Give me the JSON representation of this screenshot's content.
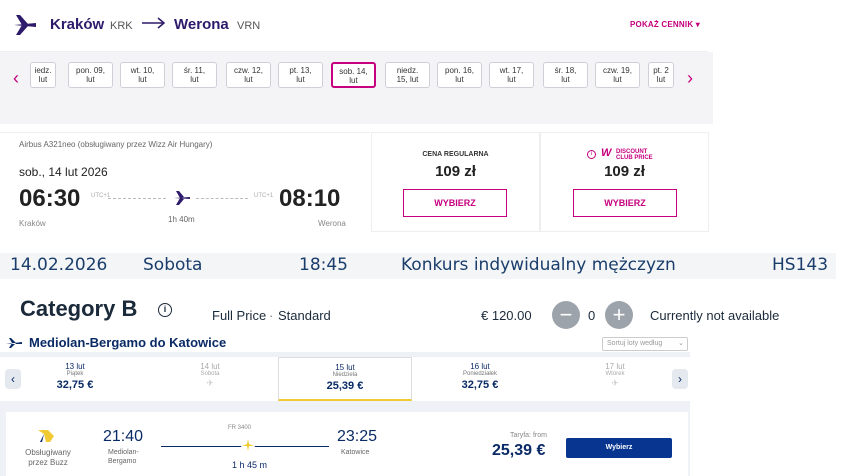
{
  "wizz": {
    "route": {
      "origin": "Kraków",
      "origin_code": "KRK",
      "destination": "Werona",
      "destination_code": "VRN",
      "price_list_label": "POKAŻ CENNIK"
    },
    "date_strip": [
      {
        "l1": "iedz.",
        "l2": "lut"
      },
      {
        "l1": "pon. 09,",
        "l2": "lut"
      },
      {
        "l1": "wt. 10,",
        "l2": "lut"
      },
      {
        "l1": "śr. 11,",
        "l2": "lut"
      },
      {
        "l1": "czw. 12,",
        "l2": "lut"
      },
      {
        "l1": "pt. 13,",
        "l2": "lut"
      },
      {
        "l1": "sob. 14,",
        "l2": "lut"
      },
      {
        "l1": "niedz.",
        "l2": "15, lut"
      },
      {
        "l1": "pon. 16,",
        "l2": "lut"
      },
      {
        "l1": "wt. 17,",
        "l2": "lut"
      },
      {
        "l1": "śr. 18,",
        "l2": "lut"
      },
      {
        "l1": "czw. 19,",
        "l2": "lut"
      },
      {
        "l1": "pt. 2",
        "l2": "lut"
      }
    ],
    "selected_date_index": 6,
    "flight": {
      "aircraft": "Airbus A321neo (obsługiwany przez Wizz Air Hungary)",
      "date": "sob., 14 lut 2026",
      "dep_time": "06:30",
      "dep_utc": "UTC+1",
      "arr_time": "08:10",
      "arr_utc": "UTC+1",
      "duration": "1h 40m",
      "dep_city": "Kraków",
      "arr_city": "Werona"
    },
    "fares": {
      "regular_label": "CENA REGULARNA",
      "regular_price": "109 zł",
      "discount_label_1": "DISCOUNT",
      "discount_label_2": "CLUB PRICE",
      "discount_price": "109 zł",
      "select_label": "WYBIERZ"
    }
  },
  "event": {
    "date": "14.02.2026",
    "weekday": "Sobota",
    "time": "18:45",
    "name": "Konkurs indywidualny mężczyzn",
    "code": "HS143"
  },
  "category": {
    "title": "Category B",
    "info_glyph": "i",
    "price_type": "Full Price",
    "separator": "·",
    "tariff": "Standard",
    "price": "€ 120.00",
    "minus": "−",
    "quantity": "0",
    "plus": "+",
    "availability": "Currently not available"
  },
  "ryanair": {
    "route": "Mediolan-Bergamo do Katowice",
    "sort_placeholder": "Sortuj loty według",
    "dates": [
      {
        "date": "13 lut",
        "weekday": "Piątek",
        "price": "32,75 €",
        "available": true
      },
      {
        "date": "14 lut",
        "weekday": "Sobota",
        "price": "",
        "available": false
      },
      {
        "date": "15 lut",
        "weekday": "Niedziela",
        "price": "25,39 €",
        "available": true
      },
      {
        "date": "16 lut",
        "weekday": "Poniedziałek",
        "price": "32,75 €",
        "available": true
      },
      {
        "date": "17 lut",
        "weekday": "Wtorek",
        "price": "",
        "available": false
      }
    ],
    "selected_date_index": 2,
    "flight": {
      "operated_by_1": "Obsługiwany",
      "operated_by_2": "przez Buzz",
      "dep_time": "21:40",
      "dep_airport_1": "Mediolan-",
      "dep_airport_2": "Bergamo",
      "flight_no": "FR 3400",
      "duration": "1 h 45 m",
      "arr_time": "23:25",
      "arr_airport": "Katowice",
      "fare_from_label": "Taryfa: from",
      "price": "25,39 €",
      "select_label": "Wybierz"
    }
  }
}
